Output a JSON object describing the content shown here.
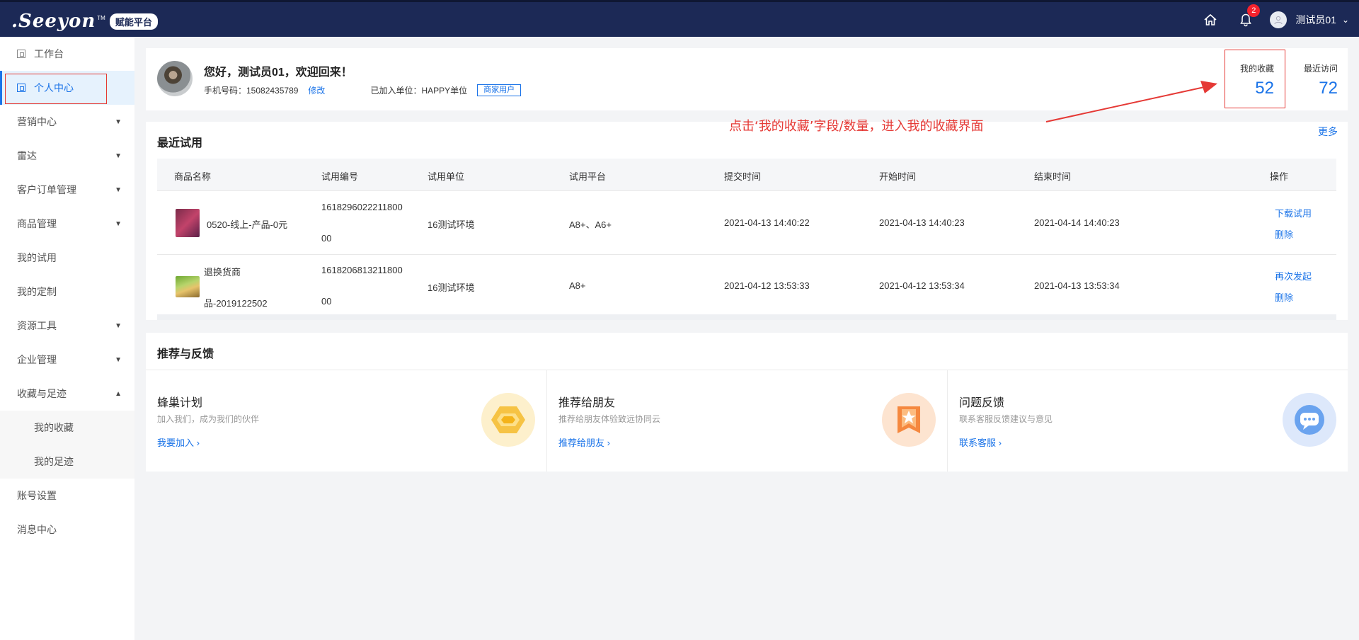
{
  "header": {
    "logo_text": ".Seeyon",
    "logo_tm": "TM",
    "logo_badge": "赋能平台",
    "notification_count": "2",
    "user_name": "测试员01"
  },
  "sidebar": {
    "items": [
      {
        "label": "工作台"
      },
      {
        "label": "个人中心"
      },
      {
        "label": "营销中心"
      },
      {
        "label": "雷达"
      },
      {
        "label": "客户订单管理"
      },
      {
        "label": "商品管理"
      },
      {
        "label": "我的试用"
      },
      {
        "label": "我的定制"
      },
      {
        "label": "资源工具"
      },
      {
        "label": "企业管理"
      },
      {
        "label": "收藏与足迹"
      },
      {
        "label": "我的收藏"
      },
      {
        "label": "我的足迹"
      },
      {
        "label": "账号设置"
      },
      {
        "label": "消息中心"
      }
    ]
  },
  "profile": {
    "greeting": "您好，测试员01，欢迎回来！",
    "phone_label": "手机号码：15082435789",
    "edit_label": "修改",
    "unit_label": "已加入单位：HAPPY单位",
    "tag": "商家用户",
    "fav_label": "我的收藏",
    "fav_value": "52",
    "recent_label": "最近访问",
    "recent_value": "72"
  },
  "annotation": {
    "text": "点击‘我的收藏’字段/数量，进入我的收藏界面"
  },
  "trials": {
    "title": "最近试用",
    "more": "更多",
    "columns": [
      "商品名称",
      "试用编号",
      "试用单位",
      "试用平台",
      "提交时间",
      "开始时间",
      "结束时间",
      "操作"
    ],
    "rows": [
      {
        "name": "0520-线上-产品-0元",
        "name_line2": "",
        "code_line1": "1618296022211800",
        "code_line2": "00",
        "unit": "16测试环境",
        "platform": "A8+、A6+",
        "submit": "2021-04-13 14:40:22",
        "start": "2021-04-13 14:40:23",
        "end": "2021-04-14 14:40:23",
        "op1": "下载试用",
        "op2": "删除"
      },
      {
        "name": "退换货商",
        "name_line2": "品-2019122502",
        "code_line1": "1618206813211800",
        "code_line2": "00",
        "unit": "16测试环境",
        "platform": "A8+",
        "submit": "2021-04-12 13:53:33",
        "start": "2021-04-12 13:53:34",
        "end": "2021-04-13 13:53:34",
        "op1": "再次发起",
        "op2": "删除"
      }
    ]
  },
  "recommend": {
    "title": "推荐与反馈",
    "items": [
      {
        "name": "蜂巢计划",
        "desc": "加入我们，成为我们的伙伴",
        "link": "我要加入"
      },
      {
        "name": "推荐给朋友",
        "desc": "推荐给朋友体验致远协同云",
        "link": "推荐给朋友"
      },
      {
        "name": "问题反馈",
        "desc": "联系客服反馈建议与意见",
        "link": "联系客服"
      }
    ]
  }
}
